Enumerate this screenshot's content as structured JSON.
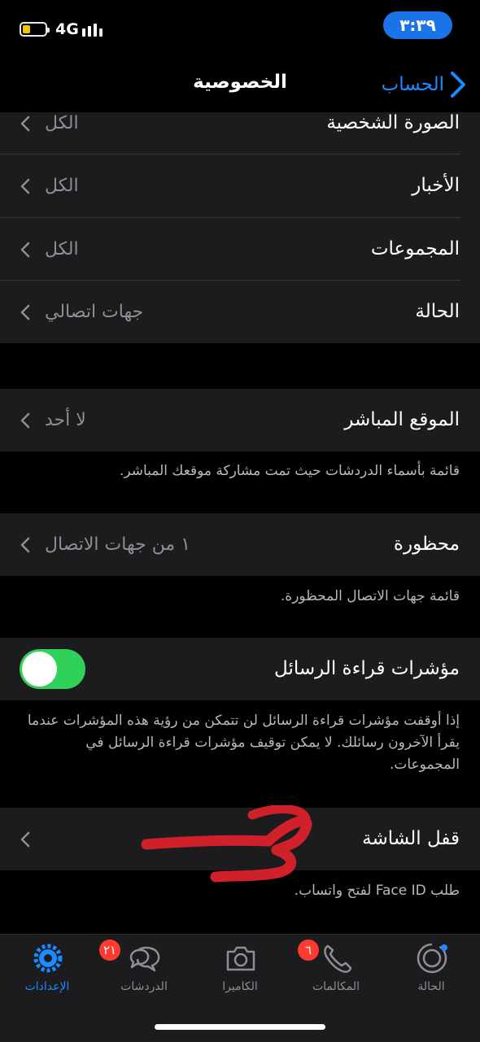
{
  "status_bar": {
    "network": "4G",
    "time": "٣:٣٩"
  },
  "nav": {
    "title": "الخصوصية",
    "back_label": "الحساب"
  },
  "rows_top": [
    {
      "label": "الصورة الشخصية",
      "value": "الكل"
    },
    {
      "label": "الأخبار",
      "value": "الكل"
    },
    {
      "label": "المجموعات",
      "value": "الكل"
    },
    {
      "label": "الحالة",
      "value": "جهات اتصالي"
    }
  ],
  "live_location": {
    "label": "الموقع المباشر",
    "value": "لا أحد",
    "footnote": "قائمة بأسماء الدردشات حيث تمت مشاركة موقعك المباشر."
  },
  "blocked": {
    "label": "محظورة",
    "value": "١ من جهات الاتصال",
    "footnote": "قائمة جهات الاتصال المحظورة."
  },
  "read_receipts": {
    "label": "مؤشرات قراءة الرسائل",
    "enabled": true,
    "footnote": "إذا أوقفت مؤشرات قراءة الرسائل لن تتمكن من رؤية هذه المؤشرات عندما يقرأ الآخرون رسائلك. لا يمكن توقيف مؤشرات قراءة الرسائل في المجموعات."
  },
  "screen_lock": {
    "label": "قفل الشاشة",
    "footnote": "طلب Face ID لفتح واتساب."
  },
  "tabs": [
    {
      "name": "status",
      "label": "الحالة",
      "icon": "status-ring-icon"
    },
    {
      "name": "calls",
      "label": "المكالمات",
      "icon": "phone-icon",
      "badge": "٦"
    },
    {
      "name": "camera",
      "label": "الكاميرا",
      "icon": "camera-icon"
    },
    {
      "name": "chats",
      "label": "الدردشات",
      "icon": "chat-bubbles-icon",
      "badge": "٢١"
    },
    {
      "name": "settings",
      "label": "الإعدادات",
      "icon": "gear-icon",
      "active": true
    }
  ],
  "colors": {
    "accent": "#1a8cff",
    "toggle_on": "#30d158",
    "badge": "#ff3b30",
    "battery": "#f5c400",
    "annotation": "#d0202a"
  }
}
